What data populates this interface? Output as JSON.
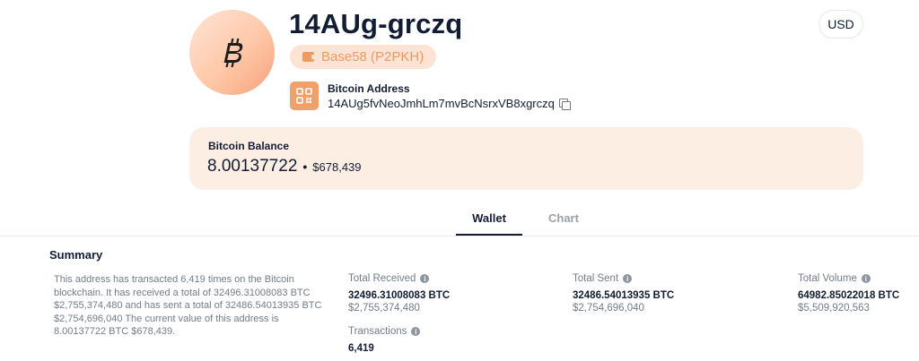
{
  "header": {
    "title": "14AUg-grczq",
    "format_pill": "Base58 (P2PKH)",
    "address_label": "Bitcoin Address",
    "address_value": "14AUg5fvNeoJmhLm7mvBcNsrxVB8xgrczq",
    "currency_button": "USD",
    "avatar_icon": "bitcoin-icon",
    "accent_color": "#ee9a63"
  },
  "balance": {
    "label": "Bitcoin Balance",
    "btc": "8.00137722",
    "separator": "•",
    "usd": "$678,439"
  },
  "tabs": [
    {
      "label": "Wallet",
      "active": true
    },
    {
      "label": "Chart",
      "active": false
    }
  ],
  "summary": {
    "title": "Summary",
    "text": "This address has transacted 6,419 times on the Bitcoin blockchain. It has received a total of 32496.31008083 BTC $2,755,374,480 and has sent a total of 32486.54013935 BTC $2,754,696,040 The current value of this address is 8.00137722 BTC $678,439.",
    "stats": {
      "received": {
        "label": "Total Received",
        "btc": "32496.31008083 BTC",
        "usd": "$2,755,374,480"
      },
      "sent": {
        "label": "Total Sent",
        "btc": "32486.54013935 BTC",
        "usd": "$2,754,696,040"
      },
      "volume": {
        "label": "Total Volume",
        "btc": "64982.85022018 BTC",
        "usd": "$5,509,920,563"
      },
      "transactions": {
        "label": "Transactions",
        "value": "6,419"
      }
    }
  }
}
